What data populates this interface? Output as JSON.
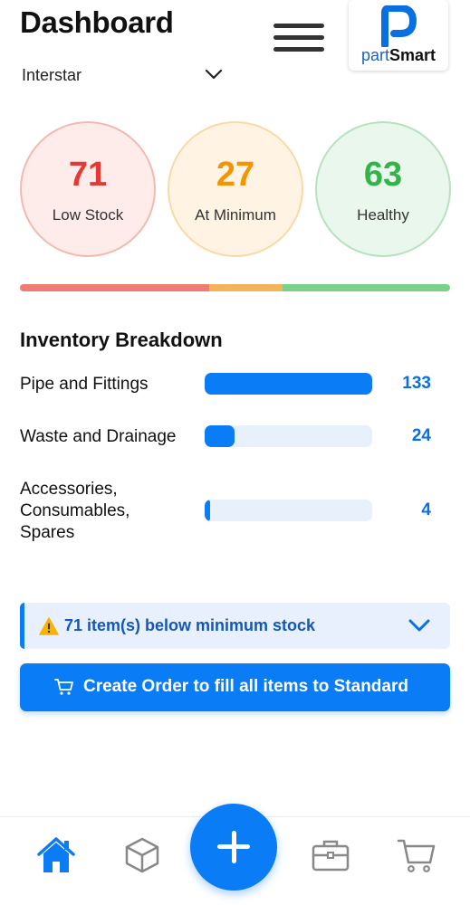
{
  "header": {
    "title": "Dashboard",
    "store": "Interstar",
    "logo": {
      "brand_part": "part",
      "brand_smart": "Smart"
    }
  },
  "stats": [
    {
      "value": "71",
      "label": "Low Stock",
      "color": "#e53935"
    },
    {
      "value": "27",
      "label": "At Minimum",
      "color": "#f59300"
    },
    {
      "value": "63",
      "label": "Healthy",
      "color": "#34b34a"
    }
  ],
  "stock_ratio": [
    {
      "label": "Low Stock",
      "fraction": 0.44,
      "color": "#ef7b72"
    },
    {
      "label": "At Minimum",
      "fraction": 0.17,
      "color": "#f2b35b"
    },
    {
      "label": "Healthy",
      "fraction": 0.39,
      "color": "#7bd08a"
    }
  ],
  "breakdown": {
    "title": "Inventory Breakdown",
    "categories": [
      {
        "label": "Pipe and Fittings",
        "value": "133",
        "fraction": 1.0
      },
      {
        "label": "Waste and Drainage",
        "value": "24",
        "fraction": 0.18
      },
      {
        "label": "Accessories, Consumables, Spares",
        "value": "4",
        "fraction": 0.03
      }
    ]
  },
  "alert": {
    "text": "71 item(s) below minimum stock",
    "icon": "warning-icon"
  },
  "order_button": {
    "label": "Create Order to fill all items to Standard",
    "icon": "cart-icon"
  },
  "nav": {
    "items": [
      "home-icon",
      "box-icon",
      "add-icon",
      "briefcase-icon",
      "cart-icon"
    ],
    "active": "home-icon",
    "active_color": "#0a7cf5",
    "inactive_color": "#888888"
  }
}
